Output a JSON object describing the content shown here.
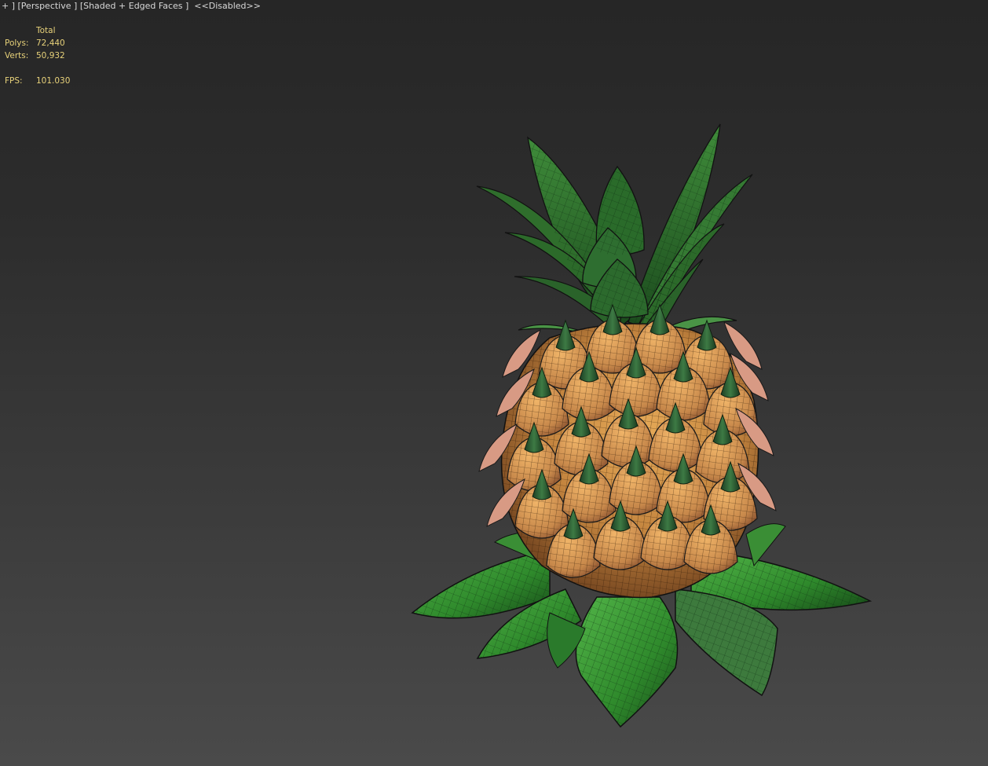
{
  "viewport": {
    "menu_label": "+ ]",
    "view_label": "[Perspective ]",
    "shading_label": "[Shaded + Edged Faces ]",
    "disabled_label": "<<Disabled>>"
  },
  "stats": {
    "header": "Total",
    "polys_label": "Polys:",
    "polys_value": "72,440",
    "verts_label": "Verts:",
    "verts_value": "50,932",
    "fps_label": "FPS:",
    "fps_value": "101.030"
  },
  "model": {
    "object": "pineapple-mesh",
    "colors": {
      "leaf": "#3f9a3a",
      "leaf_dark": "#1f5a22",
      "fruit": "#c58845",
      "fruit_light": "#e3a95c",
      "scale_edge": "#d79a85",
      "spike": "#2c5a33",
      "wire": "#1a1a1a"
    }
  }
}
